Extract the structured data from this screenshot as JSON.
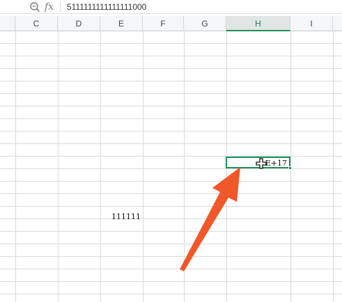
{
  "formula_bar": {
    "zoom_icon": "magnifier-icon",
    "fx_label": "fx",
    "value": "5111111111111111000"
  },
  "columns": [
    {
      "label": "C"
    },
    {
      "label": "D"
    },
    {
      "label": "E"
    },
    {
      "label": "F"
    },
    {
      "label": "G"
    },
    {
      "label": "H",
      "active": true
    },
    {
      "label": "I"
    }
  ],
  "cells": {
    "e_value": "111111",
    "h_value": "E+17"
  },
  "selection": {
    "column": "H"
  },
  "annotation": {
    "icon": "arrow-icon",
    "color": "#f0582a"
  },
  "colors": {
    "accent": "#1f8f5a",
    "gridline": "#dadada"
  }
}
